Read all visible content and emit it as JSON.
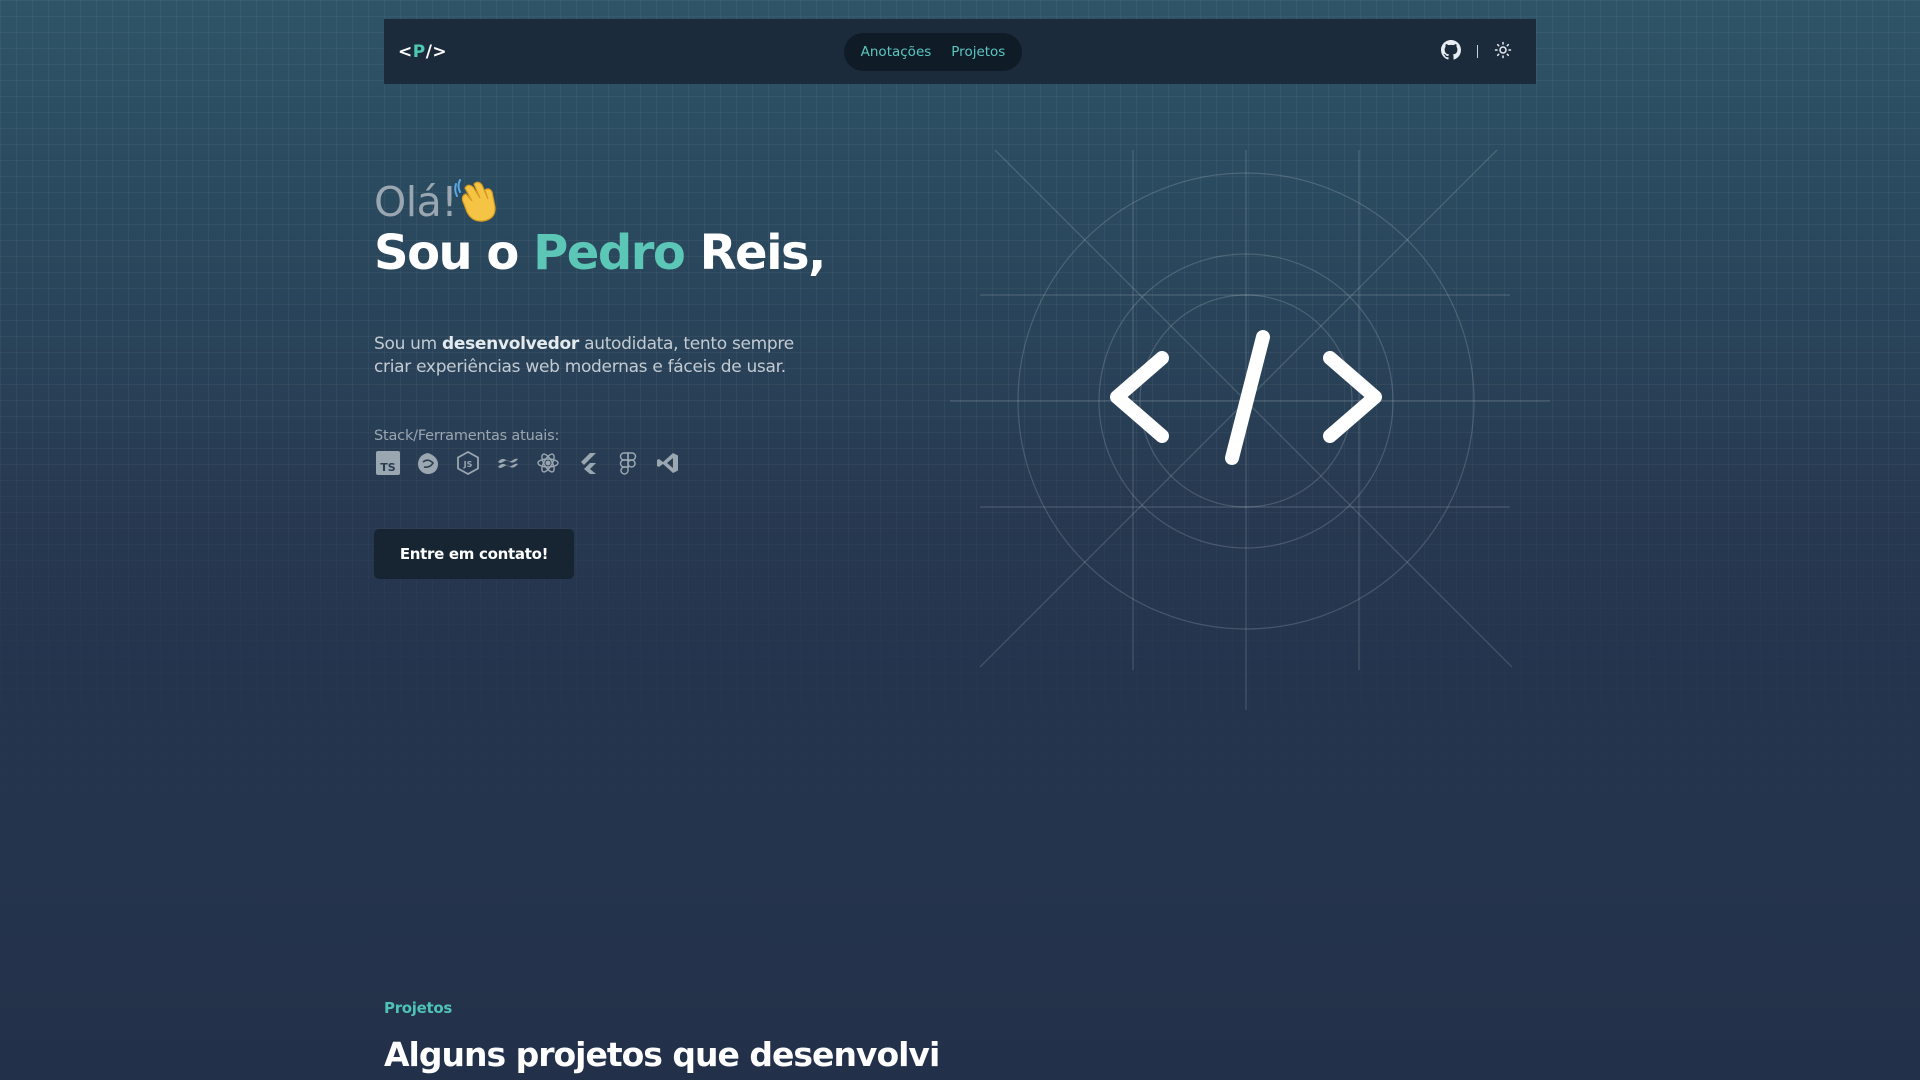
{
  "nav": {
    "logo_left": "<",
    "logo_mid": "P",
    "logo_right": "/>",
    "links": [
      "Anotações",
      "Projetos"
    ]
  },
  "hero": {
    "greeting": "Olá!",
    "headline_pre": "Sou o ",
    "headline_name": "Pedro",
    "headline_post": " Reis,",
    "desc_1": "Sou um ",
    "desc_bold": "desenvolvedor",
    "desc_2": " autodidata, tento sempre criar experiências web modernas e fáceis de usar.",
    "stack_label": "Stack/Ferramentas atuais:",
    "stack_icons": [
      "typescript-icon",
      "nestjs-icon",
      "nodejs-icon",
      "tailwind-icon",
      "react-icon",
      "flutter-icon",
      "figma-icon",
      "vscode-icon"
    ],
    "cta_label": "Entre em contato!"
  },
  "projects": {
    "label": "Projetos",
    "title": "Alguns projetos que desenvolvi"
  },
  "colors": {
    "accent": "#5cc7b6",
    "navbar": "#1b2b3b",
    "button": "#172533"
  }
}
